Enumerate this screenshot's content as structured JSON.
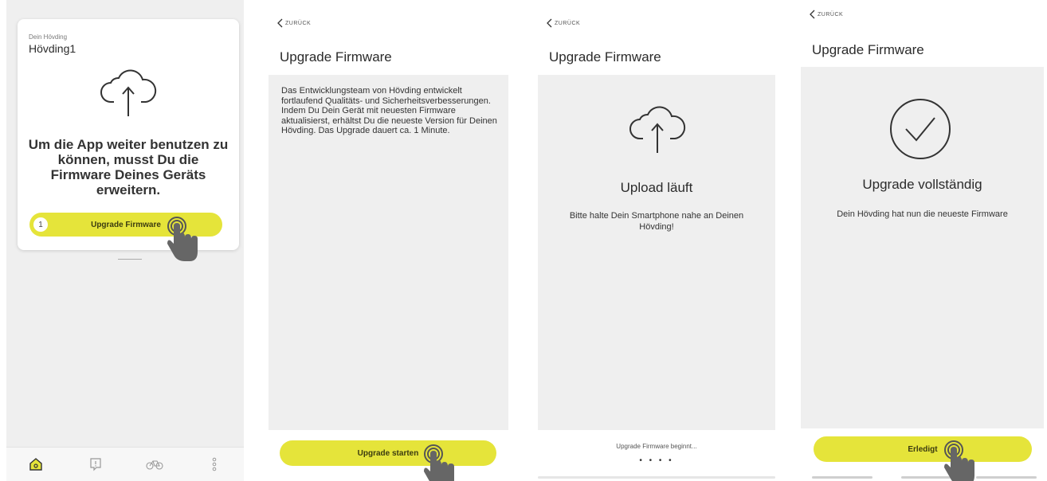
{
  "screen1": {
    "device_label": "Dein Hövding",
    "device_name": "Hövding1",
    "message": "Um die App weiter benutzen zu können, musst Du die Firmware Deines Geräts erweitern.",
    "step_number": "1",
    "upgrade_button": "Upgrade Firmware",
    "tabs": [
      {
        "icon": "home-icon"
      },
      {
        "icon": "alert-icon"
      },
      {
        "icon": "bike-icon"
      },
      {
        "icon": "more-icon"
      }
    ]
  },
  "screen2": {
    "back_label": "ZURÜCK",
    "title": "Upgrade Firmware",
    "description": "Das Entwicklungsteam von Hövding entwickelt fortlaufend Qualitäts- und Sicherheitsverbesserungen. Indem Du Dein Gerät mit neuesten Firmware aktualisierst, erhältst Du die neueste Version für Deinen Hövding. Das Upgrade dauert ca. 1 Minute.",
    "start_button": "Upgrade starten"
  },
  "screen3": {
    "back_label": "ZURÜCK",
    "title": "Upgrade Firmware",
    "status": "Upload läuft",
    "instruction": "Bitte halte Dein Smartphone nahe an Deinen Hövding!",
    "progress_text": "Upgrade Firmware beginnt...",
    "progress_dots": "• • • •"
  },
  "screen4": {
    "back_label": "ZURÜCK",
    "title": "Upgrade Firmware",
    "status": "Upgrade vollständig",
    "message": "Dein Hövding hat nun die neueste Firmware",
    "done_button": "Erledigt"
  },
  "colors": {
    "accent_yellow": "#e5e43a",
    "background_gray": "#efefef"
  }
}
